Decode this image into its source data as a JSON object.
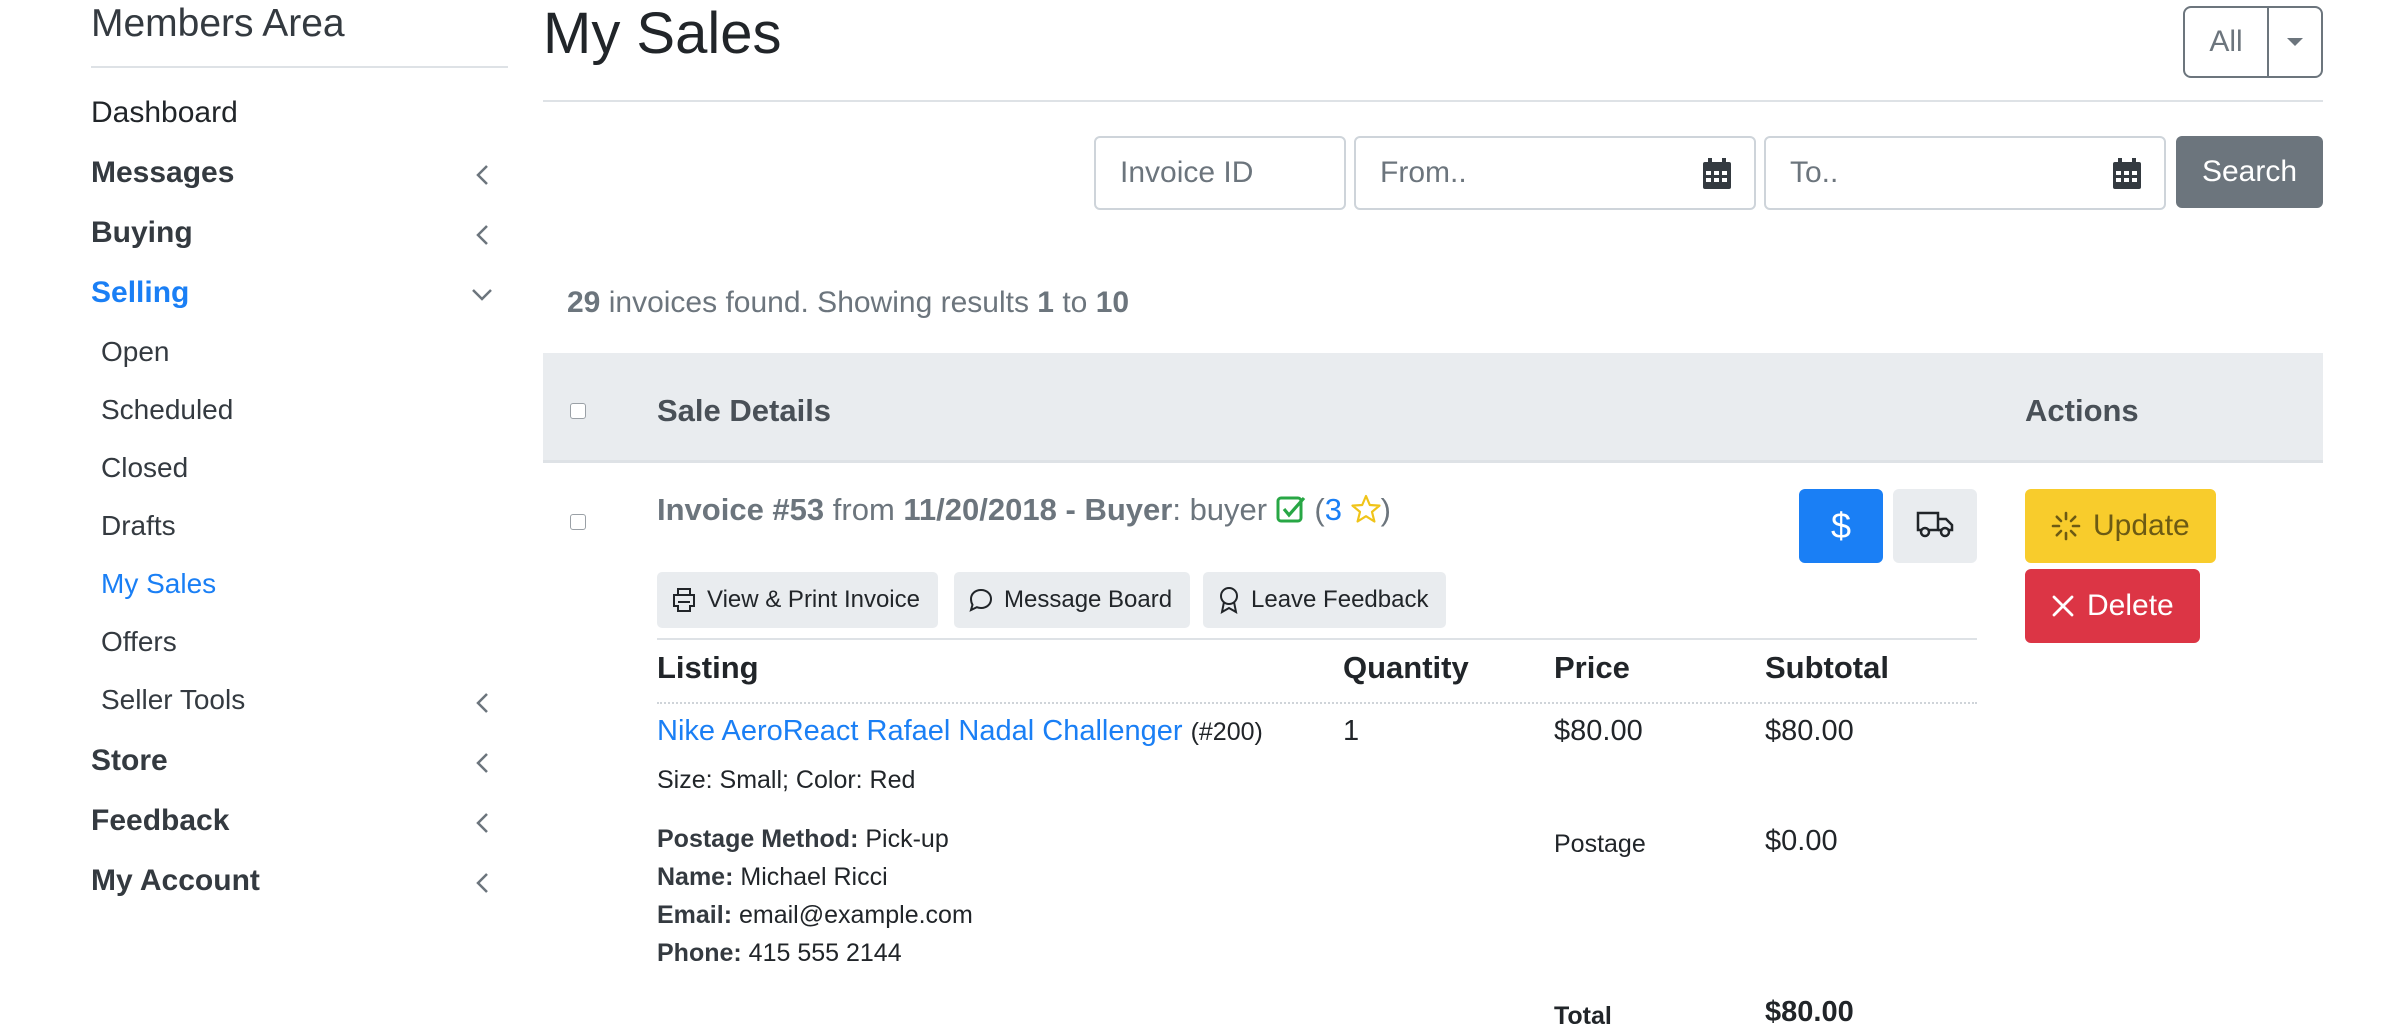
{
  "sidebar": {
    "title": "Members Area",
    "items": [
      {
        "label": "Dashboard"
      },
      {
        "label": "Messages"
      },
      {
        "label": "Buying"
      },
      {
        "label": "Selling"
      },
      {
        "label": "Store"
      },
      {
        "label": "Feedback"
      },
      {
        "label": "My Account"
      }
    ],
    "selling_sub": [
      {
        "label": "Open"
      },
      {
        "label": "Scheduled"
      },
      {
        "label": "Closed"
      },
      {
        "label": "Drafts"
      },
      {
        "label": "My Sales"
      },
      {
        "label": "Offers"
      },
      {
        "label": "Seller Tools"
      }
    ]
  },
  "header": {
    "title": "My Sales",
    "filter_label": "All"
  },
  "search": {
    "invoice_placeholder": "Invoice ID",
    "from_placeholder": "From..",
    "to_placeholder": "To..",
    "button_label": "Search"
  },
  "results": {
    "count": "29",
    "text_found": "invoices found. Showing results",
    "start": "1",
    "to_word": "to",
    "end": "10"
  },
  "table": {
    "col_details": "Sale Details",
    "col_actions": "Actions"
  },
  "invoice": {
    "label": "Invoice #53",
    "from_word": "from",
    "date": "11/20/2018",
    "dash": "-",
    "buyer_label": "Buyer",
    "buyer_colon": ":",
    "buyer_name": "buyer",
    "rating_open": "(",
    "rating": "3",
    "rating_close": ")",
    "btn_view_print": "View & Print Invoice",
    "btn_message_board": "Message Board",
    "btn_leave_feedback": "Leave Feedback",
    "btn_update": "Update",
    "btn_delete": "Delete",
    "payment_icon": "dollar-icon",
    "shipping_icon": "truck-icon",
    "columns": [
      "Listing",
      "Quantity",
      "Price",
      "Subtotal"
    ],
    "listing_title": "Nike AeroReact Rafael Nadal Challenger",
    "listing_id": "(#200)",
    "listing_options": "Size: Small; Color: Red",
    "quantity": "1",
    "price": "$80.00",
    "subtotal": "$80.00",
    "postage_label": "Postage",
    "postage_value": "$0.00",
    "total_label": "Total",
    "total_value": "$80.00",
    "postage_method_label": "Postage Method:",
    "postage_method": "Pick-up",
    "name_label": "Name:",
    "name": "Michael Ricci",
    "email_label": "Email:",
    "email": "email@example.com",
    "phone_label": "Phone:",
    "phone": "415 555 2144"
  },
  "colors": {
    "primary": "#1a7ff5",
    "warning": "#f8cc2c",
    "danger": "#dc3545",
    "secondary": "#6c757d",
    "success": "#28a745"
  }
}
